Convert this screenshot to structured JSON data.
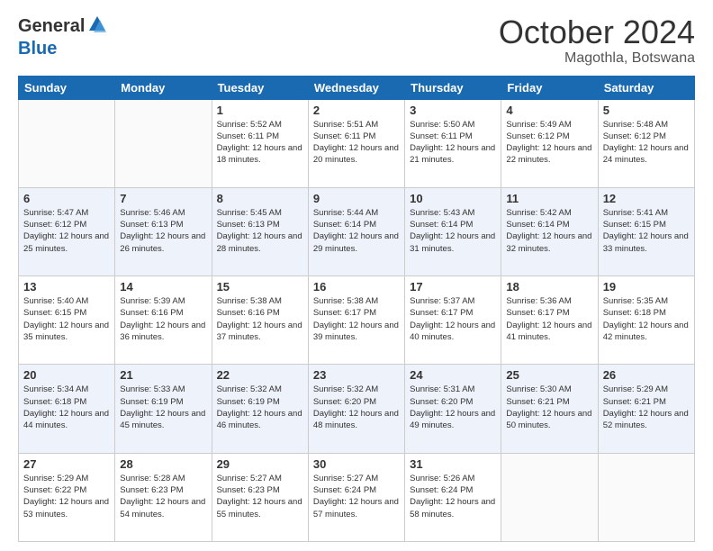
{
  "logo": {
    "general": "General",
    "blue": "Blue"
  },
  "title": {
    "month": "October 2024",
    "location": "Magothla, Botswana"
  },
  "days": [
    "Sunday",
    "Monday",
    "Tuesday",
    "Wednesday",
    "Thursday",
    "Friday",
    "Saturday"
  ],
  "weeks": [
    [
      {
        "day": "",
        "info": ""
      },
      {
        "day": "",
        "info": ""
      },
      {
        "day": "1",
        "info": "Sunrise: 5:52 AM\nSunset: 6:11 PM\nDaylight: 12 hours and 18 minutes."
      },
      {
        "day": "2",
        "info": "Sunrise: 5:51 AM\nSunset: 6:11 PM\nDaylight: 12 hours and 20 minutes."
      },
      {
        "day": "3",
        "info": "Sunrise: 5:50 AM\nSunset: 6:11 PM\nDaylight: 12 hours and 21 minutes."
      },
      {
        "day": "4",
        "info": "Sunrise: 5:49 AM\nSunset: 6:12 PM\nDaylight: 12 hours and 22 minutes."
      },
      {
        "day": "5",
        "info": "Sunrise: 5:48 AM\nSunset: 6:12 PM\nDaylight: 12 hours and 24 minutes."
      }
    ],
    [
      {
        "day": "6",
        "info": "Sunrise: 5:47 AM\nSunset: 6:12 PM\nDaylight: 12 hours and 25 minutes."
      },
      {
        "day": "7",
        "info": "Sunrise: 5:46 AM\nSunset: 6:13 PM\nDaylight: 12 hours and 26 minutes."
      },
      {
        "day": "8",
        "info": "Sunrise: 5:45 AM\nSunset: 6:13 PM\nDaylight: 12 hours and 28 minutes."
      },
      {
        "day": "9",
        "info": "Sunrise: 5:44 AM\nSunset: 6:14 PM\nDaylight: 12 hours and 29 minutes."
      },
      {
        "day": "10",
        "info": "Sunrise: 5:43 AM\nSunset: 6:14 PM\nDaylight: 12 hours and 31 minutes."
      },
      {
        "day": "11",
        "info": "Sunrise: 5:42 AM\nSunset: 6:14 PM\nDaylight: 12 hours and 32 minutes."
      },
      {
        "day": "12",
        "info": "Sunrise: 5:41 AM\nSunset: 6:15 PM\nDaylight: 12 hours and 33 minutes."
      }
    ],
    [
      {
        "day": "13",
        "info": "Sunrise: 5:40 AM\nSunset: 6:15 PM\nDaylight: 12 hours and 35 minutes."
      },
      {
        "day": "14",
        "info": "Sunrise: 5:39 AM\nSunset: 6:16 PM\nDaylight: 12 hours and 36 minutes."
      },
      {
        "day": "15",
        "info": "Sunrise: 5:38 AM\nSunset: 6:16 PM\nDaylight: 12 hours and 37 minutes."
      },
      {
        "day": "16",
        "info": "Sunrise: 5:38 AM\nSunset: 6:17 PM\nDaylight: 12 hours and 39 minutes."
      },
      {
        "day": "17",
        "info": "Sunrise: 5:37 AM\nSunset: 6:17 PM\nDaylight: 12 hours and 40 minutes."
      },
      {
        "day": "18",
        "info": "Sunrise: 5:36 AM\nSunset: 6:17 PM\nDaylight: 12 hours and 41 minutes."
      },
      {
        "day": "19",
        "info": "Sunrise: 5:35 AM\nSunset: 6:18 PM\nDaylight: 12 hours and 42 minutes."
      }
    ],
    [
      {
        "day": "20",
        "info": "Sunrise: 5:34 AM\nSunset: 6:18 PM\nDaylight: 12 hours and 44 minutes."
      },
      {
        "day": "21",
        "info": "Sunrise: 5:33 AM\nSunset: 6:19 PM\nDaylight: 12 hours and 45 minutes."
      },
      {
        "day": "22",
        "info": "Sunrise: 5:32 AM\nSunset: 6:19 PM\nDaylight: 12 hours and 46 minutes."
      },
      {
        "day": "23",
        "info": "Sunrise: 5:32 AM\nSunset: 6:20 PM\nDaylight: 12 hours and 48 minutes."
      },
      {
        "day": "24",
        "info": "Sunrise: 5:31 AM\nSunset: 6:20 PM\nDaylight: 12 hours and 49 minutes."
      },
      {
        "day": "25",
        "info": "Sunrise: 5:30 AM\nSunset: 6:21 PM\nDaylight: 12 hours and 50 minutes."
      },
      {
        "day": "26",
        "info": "Sunrise: 5:29 AM\nSunset: 6:21 PM\nDaylight: 12 hours and 52 minutes."
      }
    ],
    [
      {
        "day": "27",
        "info": "Sunrise: 5:29 AM\nSunset: 6:22 PM\nDaylight: 12 hours and 53 minutes."
      },
      {
        "day": "28",
        "info": "Sunrise: 5:28 AM\nSunset: 6:23 PM\nDaylight: 12 hours and 54 minutes."
      },
      {
        "day": "29",
        "info": "Sunrise: 5:27 AM\nSunset: 6:23 PM\nDaylight: 12 hours and 55 minutes."
      },
      {
        "day": "30",
        "info": "Sunrise: 5:27 AM\nSunset: 6:24 PM\nDaylight: 12 hours and 57 minutes."
      },
      {
        "day": "31",
        "info": "Sunrise: 5:26 AM\nSunset: 6:24 PM\nDaylight: 12 hours and 58 minutes."
      },
      {
        "day": "",
        "info": ""
      },
      {
        "day": "",
        "info": ""
      }
    ]
  ]
}
